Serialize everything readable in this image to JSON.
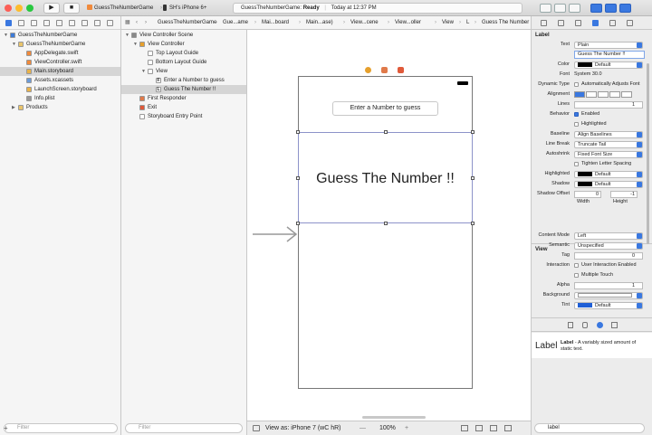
{
  "toolbar": {
    "scheme_name": "GuessTheNumberGame",
    "device": "SH's iPhone 6+",
    "status_app": "GuessTheNumberGame:",
    "status_state": "Ready",
    "status_time": "Today at 12:37 PM",
    "run_icon": "▶",
    "stop_icon": "■"
  },
  "navigator": {
    "items": [
      {
        "label": "GuessTheNumberGame",
        "indent": 0,
        "disc": "▼",
        "color": "#3d7bd8"
      },
      {
        "label": "GuessTheNumberGame",
        "indent": 1,
        "disc": "▼",
        "color": "#e9c46a"
      },
      {
        "label": "AppDelegate.swift",
        "indent": 2,
        "disc": "",
        "color": "#f08a3c"
      },
      {
        "label": "ViewController.swift",
        "indent": 2,
        "disc": "",
        "color": "#f08a3c"
      },
      {
        "label": "Main.storyboard",
        "indent": 2,
        "disc": "",
        "color": "#e8b24a",
        "selected": true
      },
      {
        "label": "Assets.xcassets",
        "indent": 2,
        "disc": "",
        "color": "#6c9bd8"
      },
      {
        "label": "LaunchScreen.storyboard",
        "indent": 2,
        "disc": "",
        "color": "#e8b24a"
      },
      {
        "label": "Info.plist",
        "indent": 2,
        "disc": "",
        "color": "#999999"
      },
      {
        "label": "Products",
        "indent": 1,
        "disc": "▶",
        "color": "#e9c46a"
      }
    ],
    "filter_placeholder": "Filter"
  },
  "outline": {
    "items": [
      {
        "label": "View Controller Scene",
        "indent": 0,
        "disc": "▼",
        "color": "#888888"
      },
      {
        "label": "View Controller",
        "indent": 1,
        "disc": "▼",
        "color": "#e6a02d"
      },
      {
        "label": "Top Layout Guide",
        "indent": 2,
        "disc": "",
        "color": "#ffffff"
      },
      {
        "label": "Bottom Layout Guide",
        "indent": 2,
        "disc": "",
        "color": "#ffffff"
      },
      {
        "label": "View",
        "indent": 2,
        "disc": "▼",
        "color": "#ffffff"
      },
      {
        "label": "Enter a Number to guess",
        "indent": 3,
        "disc": "",
        "color": "#ffffff",
        "glyph": "F"
      },
      {
        "label": "Guess The Number !!",
        "indent": 3,
        "disc": "",
        "color": "#ffffff",
        "glyph": "L",
        "selected": true
      },
      {
        "label": "First Responder",
        "indent": 1,
        "disc": "",
        "color": "#e07a4a"
      },
      {
        "label": "Exit",
        "indent": 1,
        "disc": "",
        "color": "#e05a3a"
      },
      {
        "label": "Storyboard Entry Point",
        "indent": 1,
        "disc": "",
        "color": "#ffffff"
      }
    ],
    "filter_placeholder": "Filter"
  },
  "jumpbar": {
    "items": [
      "GuessTheNumberGame",
      "Gue...ame",
      "Mai...board",
      "Main...ase)",
      "View...cene",
      "View...oller",
      "View",
      "L",
      "Guess The Number !!"
    ]
  },
  "canvas": {
    "button_text": "Enter a Number to guess",
    "label_text": "Guess The Number !!",
    "view_as": "View as: iPhone 7 (wC hR)",
    "zoom": "100%",
    "zoom_out": "—",
    "zoom_in": "+"
  },
  "inspector": {
    "label_section": "Label",
    "rows": [
      {
        "label": "Text",
        "value": "Plain",
        "type": "popup"
      },
      {
        "label": "",
        "value": "Guess The Number !!",
        "type": "field"
      },
      {
        "label": "Color",
        "value": "Default",
        "type": "color"
      },
      {
        "label": "Font",
        "value": "System 30.0",
        "type": "text"
      },
      {
        "label": "Dynamic Type",
        "value": "Automatically Adjusts Font",
        "type": "check"
      },
      {
        "label": "Alignment",
        "value": "",
        "type": "align"
      },
      {
        "label": "Lines",
        "value": "1",
        "type": "stepper"
      },
      {
        "label": "Behavior",
        "value": "Enabled",
        "type": "checkon"
      },
      {
        "label": "",
        "value": "Highlighted",
        "type": "check"
      },
      {
        "label": "Baseline",
        "value": "Align Baselines",
        "type": "popup"
      },
      {
        "label": "Line Break",
        "value": "Truncate Tail",
        "type": "popup"
      },
      {
        "label": "Autoshrink",
        "value": "Fixed Font Size",
        "type": "popup"
      },
      {
        "label": "",
        "value": "Tighten Letter Spacing",
        "type": "check"
      },
      {
        "label": "Highlighted",
        "value": "Default",
        "type": "color"
      },
      {
        "label": "Shadow",
        "value": "Default",
        "type": "color"
      },
      {
        "label": "Shadow Offset",
        "value": "0",
        "type": "offset"
      }
    ],
    "offset_y": "-1",
    "width_label": "Width",
    "height_label": "Height",
    "view_section": "View",
    "view_rows": [
      {
        "label": "Content Mode",
        "value": "Left",
        "type": "popup"
      },
      {
        "label": "Semantic",
        "value": "Unspecified",
        "type": "popup"
      },
      {
        "label": "Tag",
        "value": "0",
        "type": "stepper"
      },
      {
        "label": "Interaction",
        "value": "User Interaction Enabled",
        "type": "check"
      },
      {
        "label": "",
        "value": "Multiple Touch",
        "type": "check"
      },
      {
        "label": "Alpha",
        "value": "1",
        "type": "stepper"
      },
      {
        "label": "Background",
        "value": "",
        "type": "colorwhite"
      },
      {
        "label": "Tint",
        "value": "Default",
        "type": "colorblue"
      }
    ],
    "library_title": "Label",
    "library_name": "Label",
    "library_desc": " - A variably sized amount of static text.",
    "filter_text": "label"
  }
}
